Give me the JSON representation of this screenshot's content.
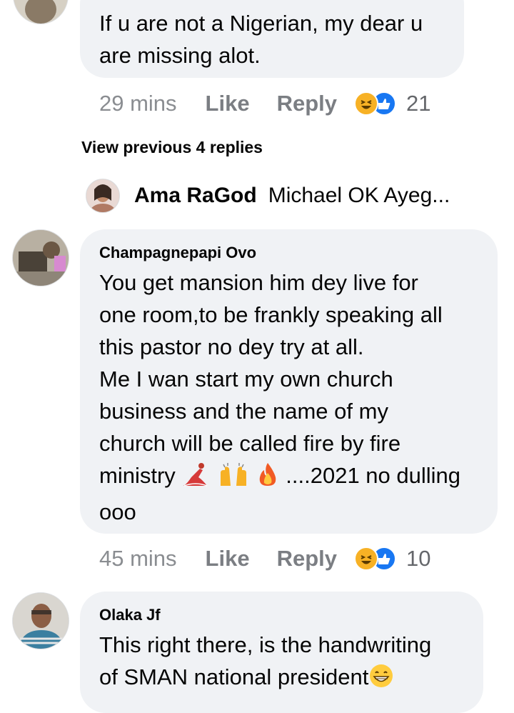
{
  "comments": [
    {
      "text_lines": [
        "If u are not a Nigerian, my dear u",
        "are missing alot."
      ],
      "time": "29 mins",
      "like_label": "Like",
      "reply_label": "Reply",
      "reaction_count": "21"
    },
    {
      "author": "Champagnepapi Ovo",
      "text_lines": [
        "You get mansion him dey live for",
        "one room,to be frankly speaking all",
        "this pastor no dey try at all.",
        "Me I wan start my own church",
        "business and the name of my",
        "church will be called fire by fire",
        "ministry",
        "ooo"
      ],
      "text_tail_after_emoji": "....2021 no dulling",
      "emojis": [
        "dancer-emoji",
        "raised-hands-emoji",
        "fire-emoji"
      ],
      "time": "45 mins",
      "like_label": "Like",
      "reply_label": "Reply",
      "reaction_count": "10"
    },
    {
      "author": "Olaka Jf",
      "text_lines": [
        "This right there, is the handwriting",
        "of SMAN national president"
      ],
      "emojis": [
        "grinning-emoji"
      ]
    }
  ],
  "view_previous": "View previous 4 replies",
  "reply_preview": {
    "name": "Ama RaGod",
    "text": "Michael OK Ayeg..."
  },
  "colors": {
    "bubble": "#f0f2f5",
    "meta": "#65676b",
    "haha": "#f7b125",
    "like": "#1877f2"
  }
}
